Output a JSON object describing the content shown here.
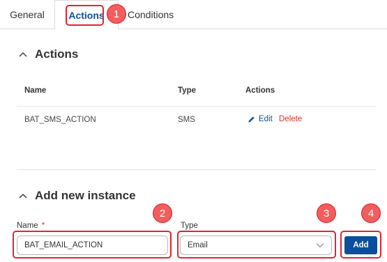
{
  "tabs": {
    "general": "General",
    "actions": "Actions",
    "conditions": "Conditions"
  },
  "markers": [
    "1",
    "2",
    "3",
    "4"
  ],
  "actions_section": {
    "title": "Actions",
    "columns": [
      "Name",
      "Type",
      "Actions"
    ],
    "rows": [
      {
        "name": "BAT_SMS_ACTION",
        "type": "SMS",
        "edit_label": "Edit",
        "delete_label": "Delete"
      }
    ]
  },
  "add_section": {
    "title": "Add new instance",
    "name_label": "Name",
    "required_mark": "*",
    "name_value": "BAT_EMAIL_ACTION",
    "type_label": "Type",
    "type_value": "Email",
    "add_label": "Add"
  },
  "colors": {
    "accent": "#0b4f9c",
    "highlight": "#e0262f",
    "marker": "#f45d5d",
    "danger": "#d4322c"
  }
}
